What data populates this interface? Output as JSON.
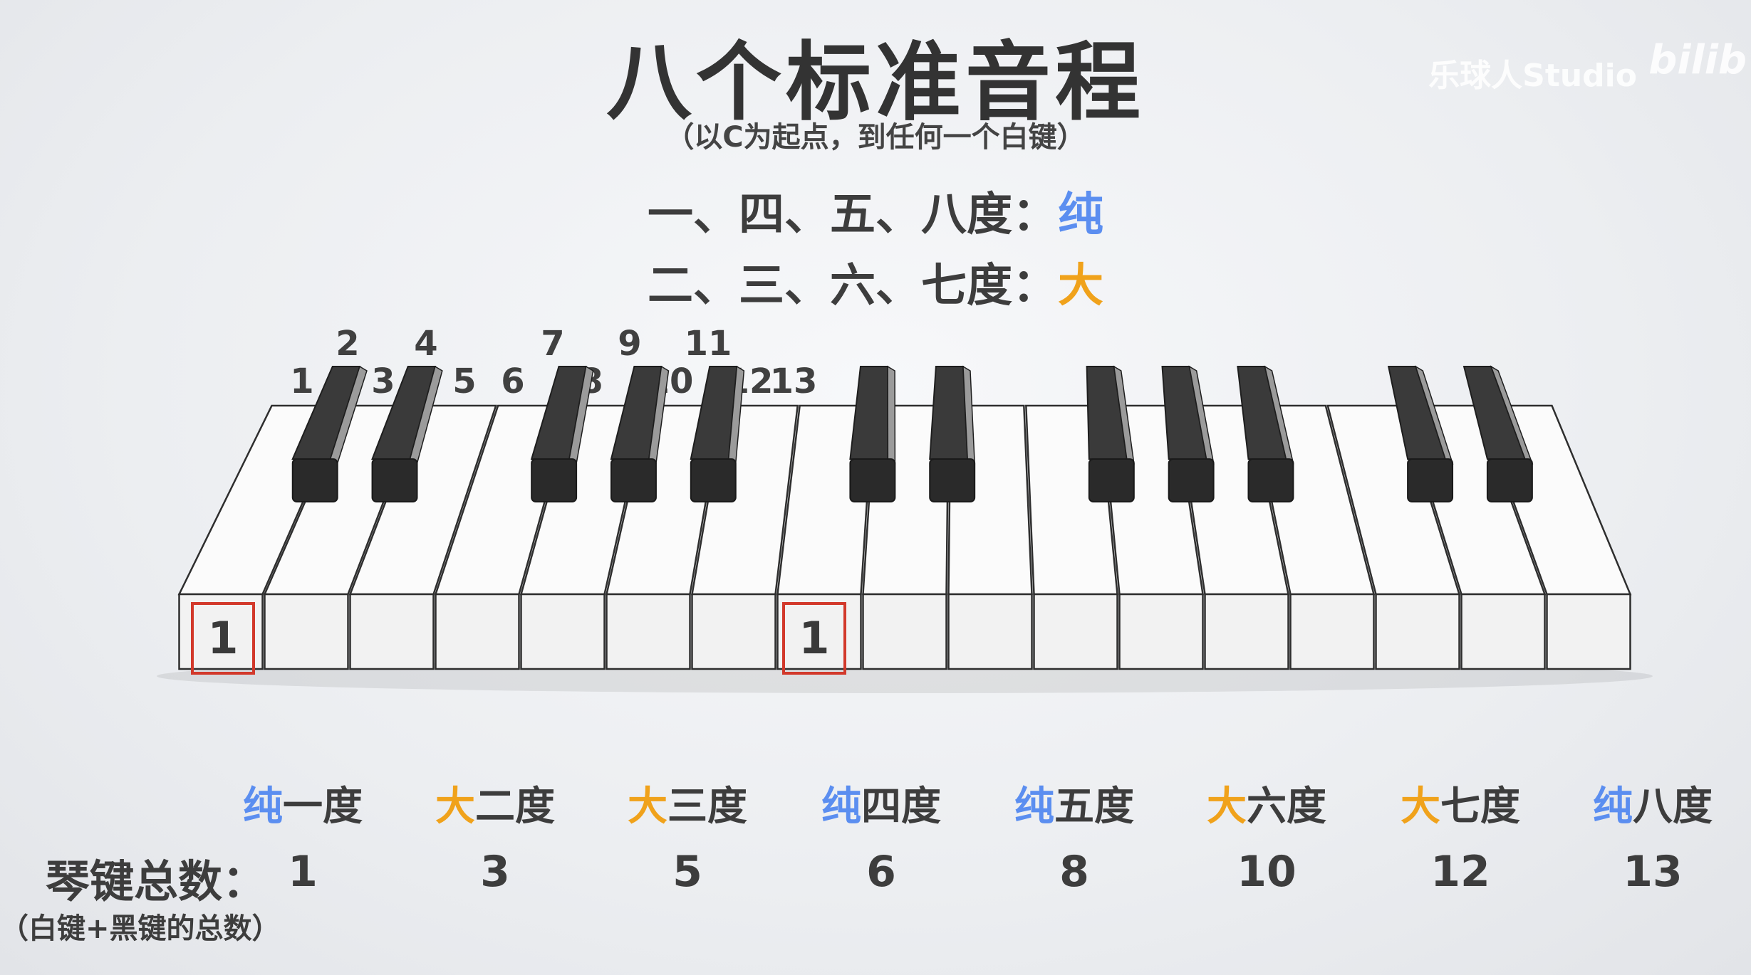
{
  "title": "八个标准音程",
  "subtitle": "（以C为起点，到任何一个白键）",
  "rules": [
    {
      "degrees": "一、四、五、八度：",
      "quality": "纯",
      "color": "#5b8ef0"
    },
    {
      "degrees": "二、三、六、七度：",
      "quality": "大",
      "color": "#f0a21b"
    }
  ],
  "watermark": "乐球人Studio",
  "logo": "bilib",
  "key_counts_upper": [
    "2",
    "4",
    "7",
    "9",
    "11"
  ],
  "key_counts_lower": [
    "1",
    "3",
    "5",
    "6",
    "8",
    "10",
    "12",
    "13"
  ],
  "highlight_labels": [
    "1",
    "1"
  ],
  "highlight_color": "#d2392b",
  "intervals": [
    {
      "quality": "纯",
      "name": "一度",
      "color": "#5b8ef0",
      "count": "1"
    },
    {
      "quality": "大",
      "name": "二度",
      "color": "#f0a21b",
      "count": "3"
    },
    {
      "quality": "大",
      "name": "三度",
      "color": "#f0a21b",
      "count": "5"
    },
    {
      "quality": "纯",
      "name": "四度",
      "color": "#5b8ef0",
      "count": "6"
    },
    {
      "quality": "纯",
      "name": "五度",
      "color": "#5b8ef0",
      "count": "8"
    },
    {
      "quality": "大",
      "name": "六度",
      "color": "#f0a21b",
      "count": "10"
    },
    {
      "quality": "大",
      "name": "七度",
      "color": "#f0a21b",
      "count": "12"
    },
    {
      "quality": "纯",
      "name": "八度",
      "color": "#5b8ef0",
      "count": "13"
    }
  ],
  "count_title": "琴键总数：",
  "count_note": "（白键+黑键的总数）"
}
